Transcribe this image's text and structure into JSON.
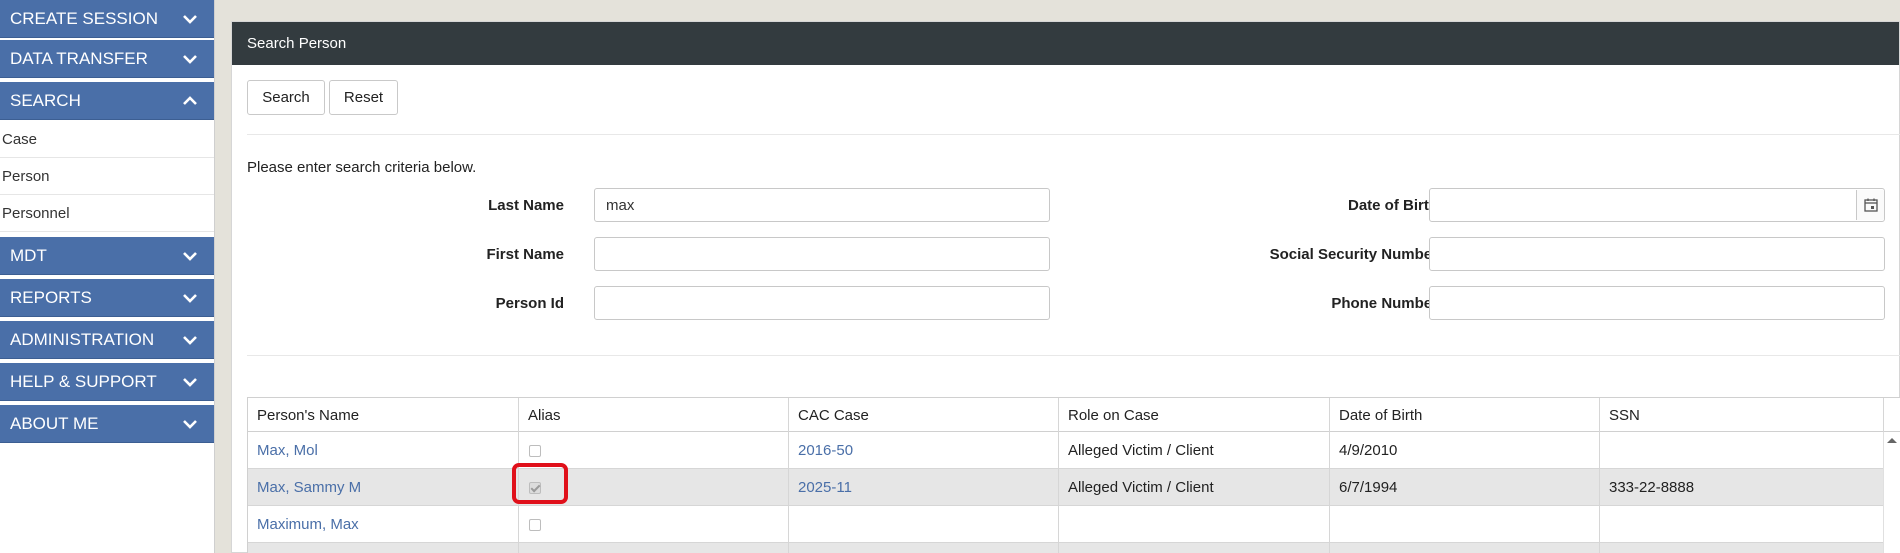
{
  "sidebar": {
    "create_session": "CREATE SESSION",
    "data_transfer": "DATA TRANSFER",
    "search": "SEARCH",
    "search_items": [
      "Case",
      "Person",
      "Personnel"
    ],
    "mdt": "MDT",
    "reports": "REPORTS",
    "administration": "ADMINISTRATION",
    "help_support": "HELP & SUPPORT",
    "about_me": "ABOUT ME"
  },
  "panel": {
    "title": "Search Person",
    "search_button": "Search",
    "reset_button": "Reset",
    "instructions": "Please enter search criteria below."
  },
  "form": {
    "last_name_label": "Last Name",
    "last_name_value": "max",
    "first_name_label": "First Name",
    "first_name_value": "",
    "person_id_label": "Person Id",
    "person_id_value": "",
    "dob_label": "Date of Birth",
    "dob_value": "",
    "ssn_label": "Social Security Number",
    "ssn_value": "",
    "phone_label": "Phone Number",
    "phone_value": ""
  },
  "grid": {
    "columns": [
      "Person's Name",
      "Alias",
      "CAC Case",
      "Role on Case",
      "Date of Birth",
      "SSN"
    ],
    "rows": [
      {
        "name": "Max, Mol",
        "alias": false,
        "case": "2016-50",
        "role": "Alleged Victim / Client",
        "dob": "4/9/2010",
        "ssn": ""
      },
      {
        "name": "Max, Sammy M",
        "alias": true,
        "case": "2025-11",
        "role": "Alleged Victim / Client",
        "dob": "6/7/1994",
        "ssn": "333-22-8888"
      },
      {
        "name": "Maximum, Max",
        "alias": false,
        "case": "",
        "role": "",
        "dob": "",
        "ssn": ""
      }
    ]
  },
  "colors": {
    "nav_blue": "#4a6fa8",
    "header_dark": "#333b3f",
    "link_blue": "#4a6fa8",
    "highlight_red": "#e0101a"
  }
}
